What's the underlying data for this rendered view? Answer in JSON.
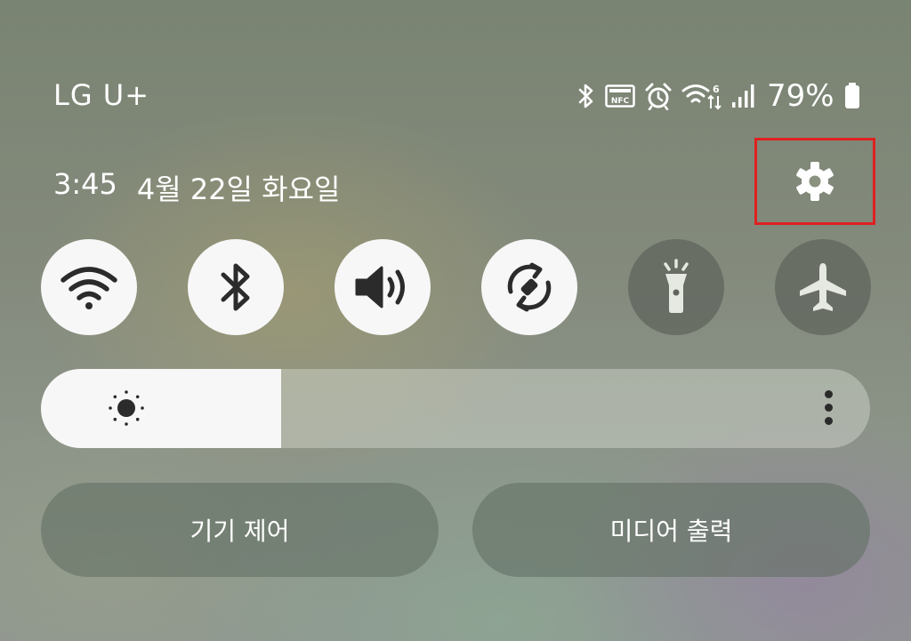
{
  "status_bar": {
    "carrier": "LG U+",
    "battery_percent": "79%",
    "icons": [
      "bluetooth-icon",
      "nfc-icon",
      "alarm-icon",
      "wifi-6-icon",
      "signal-icon",
      "battery-icon"
    ],
    "nfc_label": "NFC"
  },
  "header": {
    "time": "3:45",
    "date": "4월 22일 화요일",
    "settings_icon": "gear-icon",
    "highlight_color": "#e02020"
  },
  "toggles": [
    {
      "name": "wifi",
      "icon": "wifi-icon",
      "state": "on"
    },
    {
      "name": "bluetooth",
      "icon": "bluetooth-icon",
      "state": "on"
    },
    {
      "name": "sound",
      "icon": "volume-icon",
      "state": "on"
    },
    {
      "name": "auto-rotate",
      "icon": "rotate-icon",
      "state": "on"
    },
    {
      "name": "flashlight",
      "icon": "flashlight-icon",
      "state": "off"
    },
    {
      "name": "airplane-mode",
      "icon": "airplane-icon",
      "state": "off"
    }
  ],
  "brightness": {
    "level_percent": 29,
    "icon": "sun-icon",
    "more_icon": "more-vertical-icon"
  },
  "buttons": {
    "device_control": "기기 제어",
    "media_output": "미디어 출력"
  }
}
